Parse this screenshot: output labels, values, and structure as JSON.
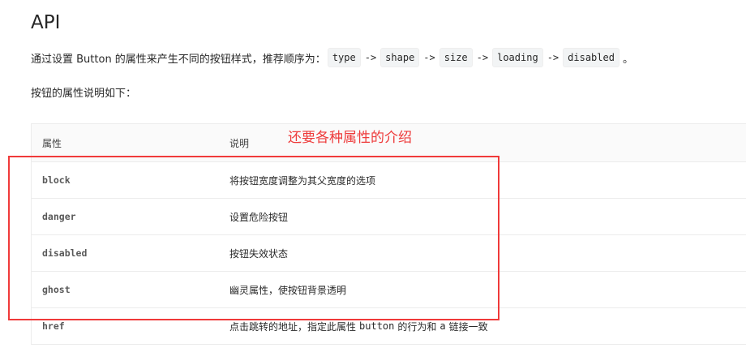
{
  "page": {
    "title": "API",
    "intro": {
      "prefix": "通过设置 Button 的属性来产生不同的按钮样式，推荐顺序为：",
      "codes": [
        "type",
        "shape",
        "size",
        "loading",
        "disabled"
      ],
      "arrow": "->",
      "suffix": "。"
    },
    "subheading": "按钮的属性说明如下："
  },
  "table": {
    "headers": {
      "property": "属性",
      "description": "说明"
    },
    "rows": [
      {
        "name": "block",
        "desc": "将按钮宽度调整为其父宽度的选项"
      },
      {
        "name": "danger",
        "desc": "设置危险按钮"
      },
      {
        "name": "disabled",
        "desc": "按钮失效状态"
      },
      {
        "name": "ghost",
        "desc": "幽灵属性，使按钮背景透明"
      },
      {
        "name": "href",
        "desc_before": "点击跳转的地址，指定此属性",
        "desc_code1": "button",
        "desc_middle": "的行为和",
        "desc_code2": "a",
        "desc_after": "链接一致"
      }
    ]
  },
  "annotation": {
    "text": "还要各种属性的介绍",
    "color": "#ee3b3b"
  }
}
